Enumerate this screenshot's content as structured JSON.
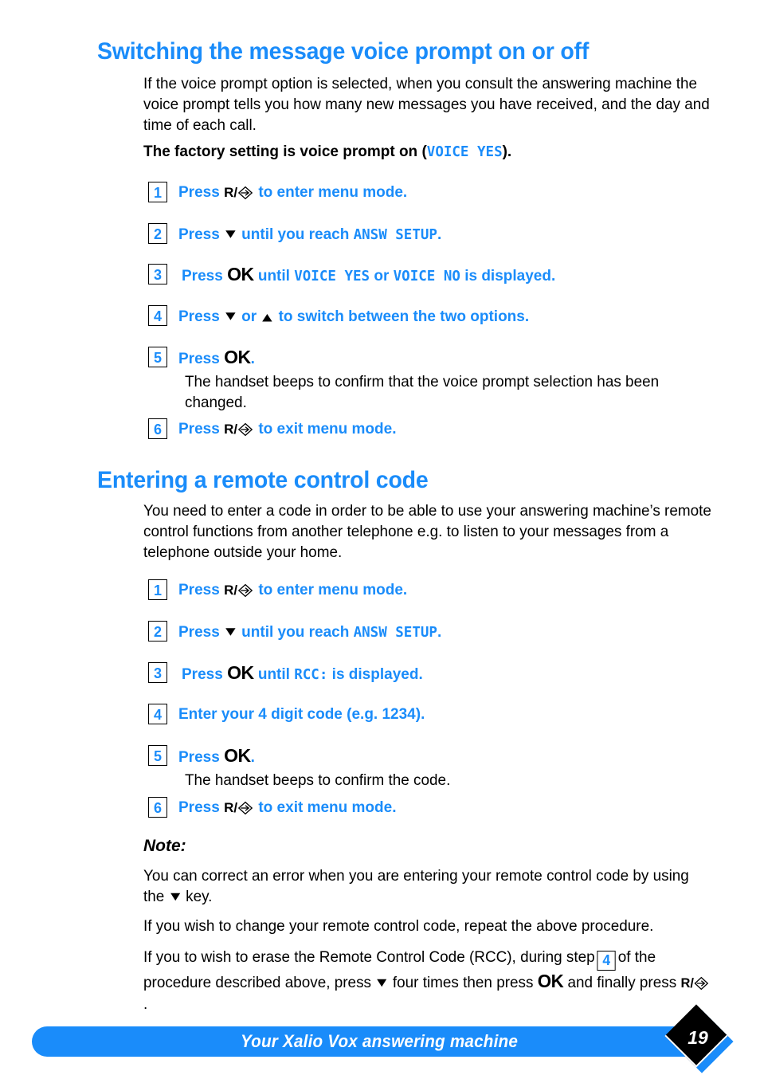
{
  "sections": [
    {
      "heading": "Switching the message voice prompt on or off",
      "intro": "If the voice prompt option is selected, when you consult the answering machine the voice prompt tells you how many new messages you have received, and the day and time of each call.",
      "factory_prefix": "The factory setting is voice prompt on (",
      "factory_value": "VOICE YES",
      "factory_suffix": ").",
      "steps": [
        {
          "num": "1",
          "parts": [
            "Press ",
            "R/",
            "[icon:r-diamond]",
            " to enter menu mode."
          ]
        },
        {
          "num": "2",
          "parts": [
            "Press ",
            "[icon:triangle-down]",
            " until you reach ",
            "ANSW SETUP",
            "."
          ]
        },
        {
          "num": "3",
          "parts": [
            "Press ",
            "OK",
            " until ",
            "VOICE YES",
            " or ",
            "VOICE NO",
            " is displayed."
          ]
        },
        {
          "num": "4",
          "parts": [
            "Press ",
            "[icon:triangle-down]",
            " or ",
            "[icon:triangle-up]",
            " to switch between the two options."
          ]
        },
        {
          "num": "5",
          "parts": [
            "Press ",
            "OK",
            "."
          ],
          "sub": "The handset beeps to confirm that the voice prompt selection has been changed."
        },
        {
          "num": "6",
          "parts": [
            "Press ",
            "R/",
            "[icon:r-diamond]",
            " to exit menu mode."
          ]
        }
      ]
    },
    {
      "heading": "Entering a remote control code",
      "intro": "You need to enter a code in order to be able to use your answering machine’s remote control functions from another telephone e.g. to listen to your messages from a telephone outside your home.",
      "steps": [
        {
          "num": "1",
          "parts": [
            "Press ",
            "R/",
            "[icon:r-diamond]",
            " to enter menu mode."
          ]
        },
        {
          "num": "2",
          "parts": [
            "Press ",
            "[icon:triangle-down]",
            " until you reach ",
            "ANSW SETUP",
            "."
          ]
        },
        {
          "num": "3",
          "parts": [
            "Press ",
            "OK",
            " until ",
            "RCC:",
            " is displayed."
          ]
        },
        {
          "num": "4",
          "parts": [
            "Enter your 4 digit code (e.g. 1234)."
          ]
        },
        {
          "num": "5",
          "parts": [
            "Press ",
            "OK",
            "."
          ],
          "sub": "The handset beeps to confirm the code."
        },
        {
          "num": "6",
          "parts": [
            "Press ",
            "R/",
            "[icon:r-diamond]",
            " to exit menu mode."
          ]
        }
      ]
    }
  ],
  "s1": {
    "heading": "Switching the message voice prompt on or off",
    "intro": "If the voice prompt option is selected, when you consult the answering machine the voice prompt tells you how many new messages you have received, and the day and time of each call.",
    "factory_prefix": "The factory setting is voice prompt on (",
    "factory_value": "VOICE YES",
    "factory_suffix": ").",
    "step1_num": "1",
    "step1_press": "Press",
    "step1_r": "R/",
    "step1_tail": "to enter menu mode.",
    "step2_num": "2",
    "step2_press": "Press",
    "step2_mid": "until you reach",
    "step2_code": "ANSW SETUP",
    "step2_end": ".",
    "step3_num": "3",
    "step3_press": "Press",
    "step3_ok": "OK",
    "step3_until": "until",
    "step3_code1": "VOICE YES",
    "step3_or": "or",
    "step3_code2": "VOICE NO",
    "step3_tail": "is displayed.",
    "step4_num": "4",
    "step4_press": "Press",
    "step4_or": "or",
    "step4_tail": "to switch between the two options.",
    "step5_num": "5",
    "step5_press": "Press",
    "step5_ok": "OK",
    "step5_dot": ".",
    "step5_sub": "The handset beeps to confirm that the voice prompt selection has been changed.",
    "step6_num": "6",
    "step6_press": "Press",
    "step6_r": "R/",
    "step6_tail": "to exit menu mode."
  },
  "s2": {
    "heading": "Entering a remote control code",
    "intro": "You need to enter a code in order to be able to use your answering machine’s remote control functions from another telephone e.g. to listen to your messages from a telephone outside your home.",
    "step1_num": "1",
    "step1_press": "Press",
    "step1_r": "R/",
    "step1_tail": "to enter menu mode.",
    "step2_num": "2",
    "step2_press": "Press",
    "step2_mid": "until you reach",
    "step2_code": "ANSW SETUP",
    "step2_end": ".",
    "step3_num": "3",
    "step3_press": "Press",
    "step3_ok": "OK",
    "step3_until": "until",
    "step3_code": "RCC:",
    "step3_tail": "is displayed.",
    "step4_num": "4",
    "step4_text": "Enter your 4 digit code (e.g. 1234).",
    "step5_num": "5",
    "step5_press": "Press",
    "step5_ok": "OK",
    "step5_dot": ".",
    "step5_sub": "The handset beeps to confirm the code.",
    "step6_num": "6",
    "step6_press": "Press",
    "step6_r": "R/",
    "step6_tail": "to exit menu mode."
  },
  "note": {
    "title": "Note:",
    "para1_a": "You can correct an error when you are entering your remote control code by using the",
    "para1_b": "key.",
    "para2": "If you wish to change your remote control code, repeat the above procedure.",
    "para3_a": "If you to wish to erase the Remote Control Code (RCC), during step",
    "para3_step": "4",
    "para3_b": "of the procedure described above, press",
    "para3_c": "four times then press",
    "para3_ok": "OK",
    "para3_d": "and finally press",
    "para3_r": "R/",
    "para3_e": "."
  },
  "footer": {
    "title": "Your Xalio Vox answering machine",
    "page_number": "19"
  },
  "colors": {
    "accent_blue": "#1a8cfa",
    "text_black": "#000000",
    "page_background": "#ffffff"
  },
  "glyphs": {
    "triangle_down": "▼",
    "triangle_up": "▲"
  }
}
